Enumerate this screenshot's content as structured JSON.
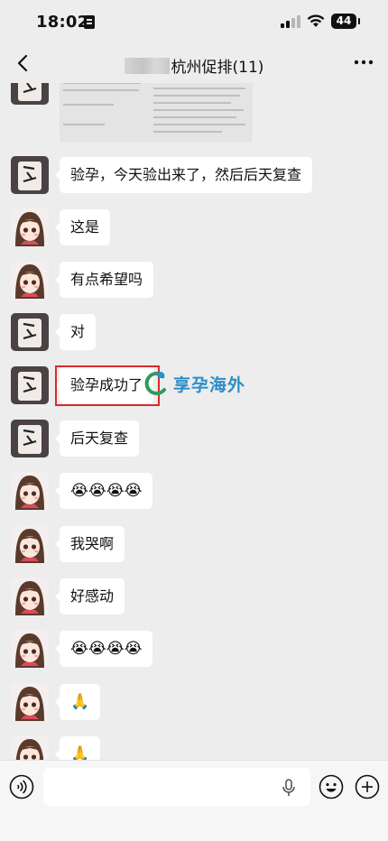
{
  "status_bar": {
    "time": "18:02",
    "battery": "44"
  },
  "header": {
    "title": "杭州促排(11)"
  },
  "messages": [
    {
      "sender": "avatar-cup",
      "type": "image"
    },
    {
      "sender": "avatar-cup",
      "type": "text",
      "text": "验孕，今天验出来了，然后后天复查"
    },
    {
      "sender": "avatar-girl",
      "type": "text",
      "text": "这是"
    },
    {
      "sender": "avatar-girl",
      "type": "text",
      "text": "有点希望吗"
    },
    {
      "sender": "avatar-cup",
      "type": "text",
      "text": "对"
    },
    {
      "sender": "avatar-cup",
      "type": "text",
      "text": "验孕成功了"
    },
    {
      "sender": "avatar-cup",
      "type": "text",
      "text": "后天复查"
    },
    {
      "sender": "avatar-girl",
      "type": "text",
      "text": "😭😭😭😭"
    },
    {
      "sender": "avatar-girl",
      "type": "text",
      "text": "我哭啊"
    },
    {
      "sender": "avatar-girl",
      "type": "text",
      "text": "好感动"
    },
    {
      "sender": "avatar-girl",
      "type": "text",
      "text": "😭😭😭😭"
    },
    {
      "sender": "avatar-girl",
      "type": "text",
      "text": "🙏"
    },
    {
      "sender": "avatar-girl",
      "type": "text",
      "text": "🙏"
    }
  ],
  "watermark": {
    "text": "享孕海外"
  },
  "input_bar": {
    "placeholder": ""
  },
  "colors": {
    "background": "#ededed",
    "bubble": "#ffffff",
    "highlight": "#d92b2b",
    "watermark": "#2a8ec9"
  }
}
